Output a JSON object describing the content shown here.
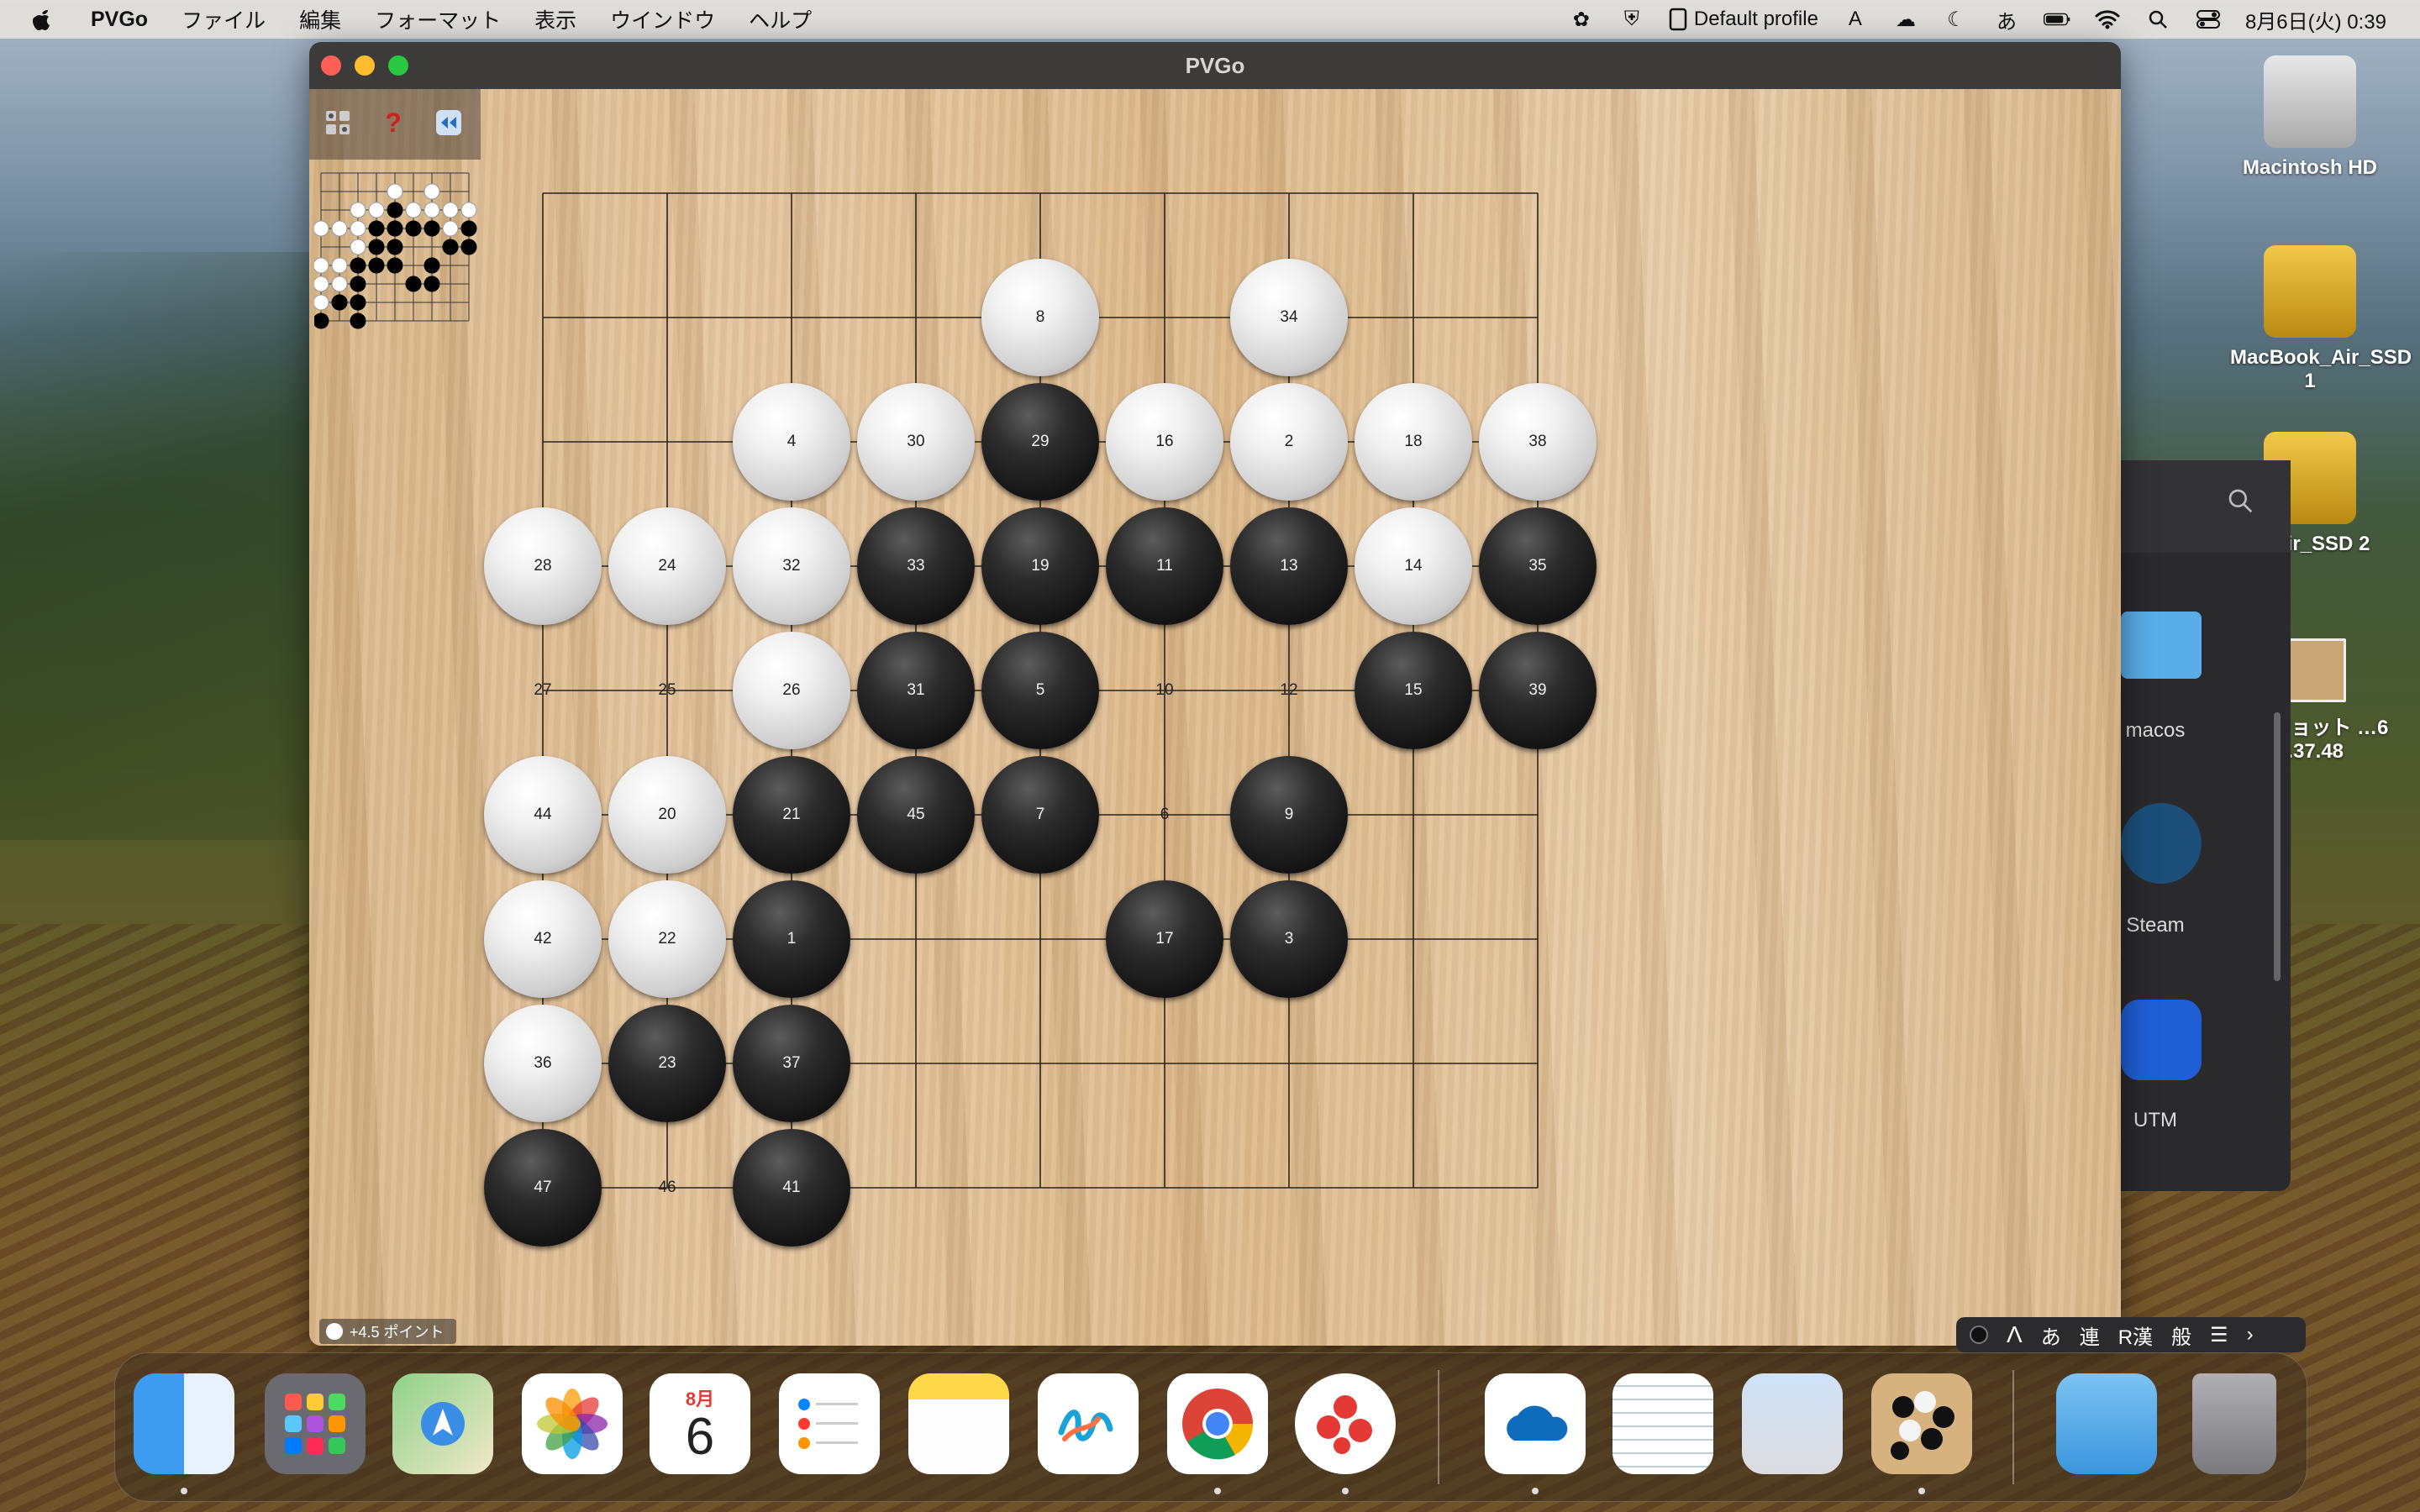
{
  "menubar": {
    "app_name": "PVGo",
    "menus": [
      "ファイル",
      "編集",
      "フォーマット",
      "表示",
      "ウインドウ",
      "ヘルプ"
    ],
    "profile": "Default profile",
    "ime": "あ",
    "clock": "8月6日(火) 0:39"
  },
  "desktop_icons": {
    "macintosh_hd": "Macintosh HD",
    "ssd1": "MacBook_Air_SSD 1",
    "ssd2": "k_Air_SSD 2",
    "screenshot": "ーンショット …6 0.37.48"
  },
  "finder_items": [
    "macos",
    "Steam",
    "UTM"
  ],
  "window": {
    "title": "PVGo",
    "status_text": "+4.5 ポイント"
  },
  "board": {
    "stones": [
      {
        "n": "1",
        "c": "black",
        "col": 2,
        "row": 6
      },
      {
        "n": "2",
        "c": "white",
        "col": 6,
        "row": 2
      },
      {
        "n": "3",
        "c": "black",
        "col": 6,
        "row": 6
      },
      {
        "n": "4",
        "c": "white",
        "col": 2,
        "row": 2
      },
      {
        "n": "5",
        "c": "black",
        "col": 4,
        "row": 4
      },
      {
        "n": "7",
        "c": "black",
        "col": 4,
        "row": 5
      },
      {
        "n": "8",
        "c": "white",
        "col": 4,
        "row": 1
      },
      {
        "n": "9",
        "c": "black",
        "col": 6,
        "row": 5
      },
      {
        "n": "11",
        "c": "black",
        "col": 5,
        "row": 3
      },
      {
        "n": "13",
        "c": "black",
        "col": 6,
        "row": 3
      },
      {
        "n": "14",
        "c": "white",
        "col": 7,
        "row": 3
      },
      {
        "n": "15",
        "c": "black",
        "col": 7,
        "row": 4
      },
      {
        "n": "16",
        "c": "white",
        "col": 5,
        "row": 2
      },
      {
        "n": "17",
        "c": "black",
        "col": 5,
        "row": 6
      },
      {
        "n": "18",
        "c": "white",
        "col": 7,
        "row": 2
      },
      {
        "n": "19",
        "c": "black",
        "col": 4,
        "row": 3
      },
      {
        "n": "20",
        "c": "white",
        "col": 1,
        "row": 5
      },
      {
        "n": "21",
        "c": "black",
        "col": 2,
        "row": 5
      },
      {
        "n": "22",
        "c": "white",
        "col": 1,
        "row": 6
      },
      {
        "n": "23",
        "c": "black",
        "col": 1,
        "row": 7
      },
      {
        "n": "24",
        "c": "white",
        "col": 1,
        "row": 3
      },
      {
        "n": "26",
        "c": "white",
        "col": 2,
        "row": 4
      },
      {
        "n": "28",
        "c": "white",
        "col": 0,
        "row": 3
      },
      {
        "n": "29",
        "c": "black",
        "col": 4,
        "row": 2
      },
      {
        "n": "30",
        "c": "white",
        "col": 3,
        "row": 2
      },
      {
        "n": "31",
        "c": "black",
        "col": 3,
        "row": 4
      },
      {
        "n": "32",
        "c": "white",
        "col": 2,
        "row": 3
      },
      {
        "n": "33",
        "c": "black",
        "col": 3,
        "row": 3
      },
      {
        "n": "34",
        "c": "white",
        "col": 6,
        "row": 1
      },
      {
        "n": "35",
        "c": "black",
        "col": 8,
        "row": 3
      },
      {
        "n": "36",
        "c": "white",
        "col": 0,
        "row": 7
      },
      {
        "n": "37",
        "c": "black",
        "col": 2,
        "row": 7
      },
      {
        "n": "38",
        "c": "white",
        "col": 8,
        "row": 2
      },
      {
        "n": "39",
        "c": "black",
        "col": 8,
        "row": 4
      },
      {
        "n": "41",
        "c": "black",
        "col": 2,
        "row": 8
      },
      {
        "n": "42",
        "c": "white",
        "col": 0,
        "row": 6
      },
      {
        "n": "44",
        "c": "white",
        "col": 0,
        "row": 5
      },
      {
        "n": "45",
        "c": "black",
        "col": 3,
        "row": 5
      },
      {
        "n": "47",
        "c": "black",
        "col": 0,
        "row": 8
      }
    ],
    "captured_labels": [
      {
        "n": "27",
        "col": 0,
        "row": 4
      },
      {
        "n": "25",
        "col": 1,
        "row": 4
      },
      {
        "n": "10",
        "col": 5,
        "row": 4
      },
      {
        "n": "12",
        "col": 6,
        "row": 4
      },
      {
        "n": "6",
        "col": 5,
        "row": 5
      },
      {
        "n": "46",
        "col": 1,
        "row": 8
      }
    ]
  },
  "imebar": {
    "a": "あ",
    "b": "連",
    "c": "R漢",
    "d": "般"
  },
  "calendar": {
    "month": "8月",
    "day": "6"
  }
}
